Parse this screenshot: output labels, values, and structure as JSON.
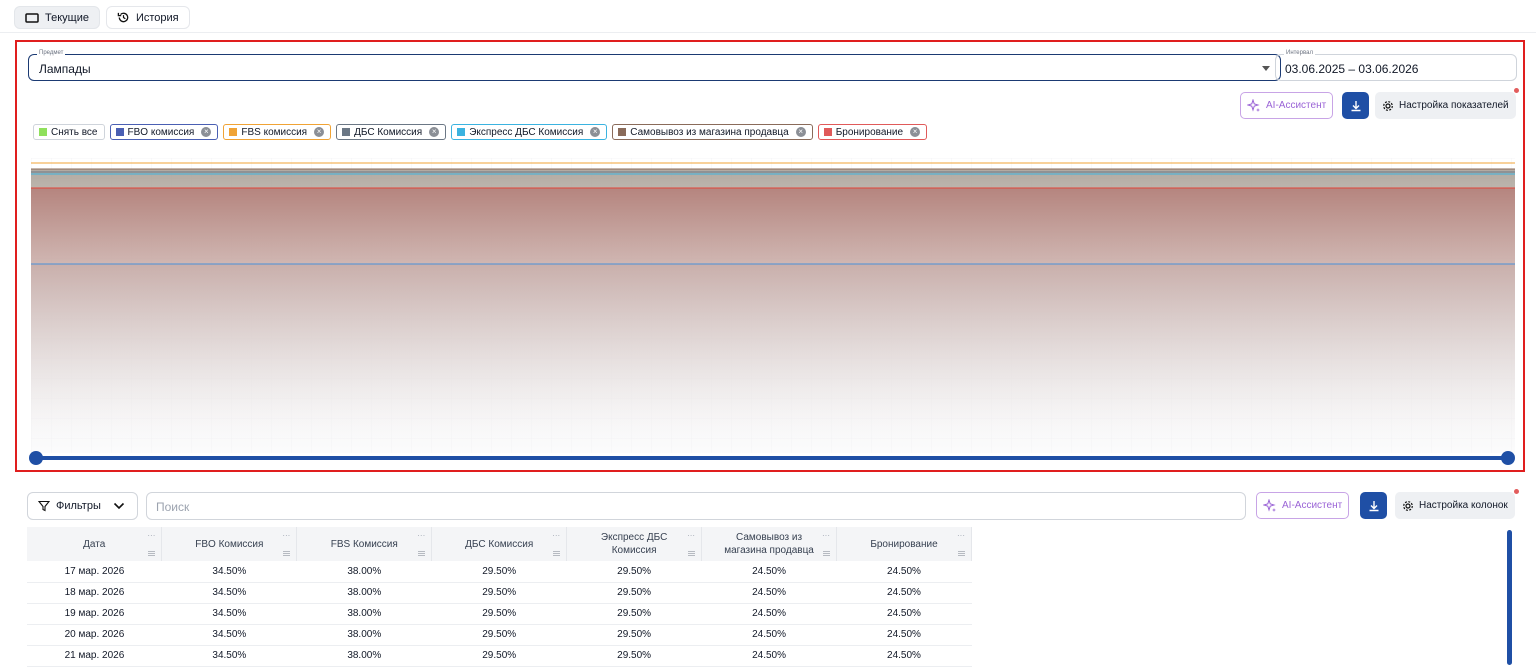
{
  "tabs": [
    {
      "label": "Текущие",
      "icon": "tablet-icon",
      "active": true
    },
    {
      "label": "История",
      "icon": "history-icon",
      "active": false
    }
  ],
  "chart_panel": {
    "subject": {
      "label": "Предмет",
      "value": "Лампады"
    },
    "interval": {
      "label": "Интервал",
      "value": "03.06.2025 – 03.06.2026"
    },
    "ai_label": "AI-Ассистент",
    "settings_label": "Настройка показателей"
  },
  "legend": [
    {
      "label": "Снять все",
      "color": "#8fe05c",
      "border": "#cfd4db",
      "removable": false
    },
    {
      "label": "FBO комиссия",
      "color": "#4a5fb3",
      "border": "#4a5fb3",
      "removable": true
    },
    {
      "label": "FBS комиссия",
      "color": "#f0a335",
      "border": "#f0a335",
      "removable": true
    },
    {
      "label": "ДБС Комиссия",
      "color": "#6b7785",
      "border": "#6b7785",
      "removable": true
    },
    {
      "label": "Экспресс ДБС Комиссия",
      "color": "#3bb3e0",
      "border": "#3bb3e0",
      "removable": true
    },
    {
      "label": "Самовывоз из магазина продавца",
      "color": "#8a6b5a",
      "border": "#8a6b5a",
      "removable": true
    },
    {
      "label": "Бронирование",
      "color": "#e05a5a",
      "border": "#e05a5a",
      "removable": true
    }
  ],
  "chart_data": {
    "type": "area",
    "series": [
      {
        "name": "FBO комиссия",
        "value": 34.5,
        "color": "#4a90d9"
      },
      {
        "name": "FBS комиссия",
        "value": 38.0,
        "color": "#f0a335"
      },
      {
        "name": "ДБС Комиссия",
        "value": 29.5,
        "color": "#6b7785"
      },
      {
        "name": "Экспресс ДБС Комиссия",
        "value": 29.5,
        "color": "#3bb3e0"
      },
      {
        "name": "Самовывоз из магазина продавца",
        "value": 24.5,
        "color": "#8a6b5a"
      },
      {
        "name": "Бронирование",
        "value": 24.5,
        "color": "#e0453a"
      }
    ],
    "grid": true
  },
  "table_section": {
    "filters_label": "Фильтры",
    "search_placeholder": "Поиск",
    "ai_label": "AI-Ассистент",
    "settings_label": "Настройка колонок",
    "columns": [
      "Дата",
      "FBO Комиссия",
      "FBS Комиссия",
      "ДБС Комиссия",
      "Экспресс ДБС Комиссия",
      "Самовывоз из магазина продавца",
      "Бронирование"
    ],
    "rows": [
      [
        "17 мар. 2026",
        "34.50%",
        "38.00%",
        "29.50%",
        "29.50%",
        "24.50%",
        "24.50%"
      ],
      [
        "18 мар. 2026",
        "34.50%",
        "38.00%",
        "29.50%",
        "29.50%",
        "24.50%",
        "24.50%"
      ],
      [
        "19 мар. 2026",
        "34.50%",
        "38.00%",
        "29.50%",
        "29.50%",
        "24.50%",
        "24.50%"
      ],
      [
        "20 мар. 2026",
        "34.50%",
        "38.00%",
        "29.50%",
        "29.50%",
        "24.50%",
        "24.50%"
      ],
      [
        "21 мар. 2026",
        "34.50%",
        "38.00%",
        "29.50%",
        "29.50%",
        "24.50%",
        "24.50%"
      ]
    ]
  }
}
